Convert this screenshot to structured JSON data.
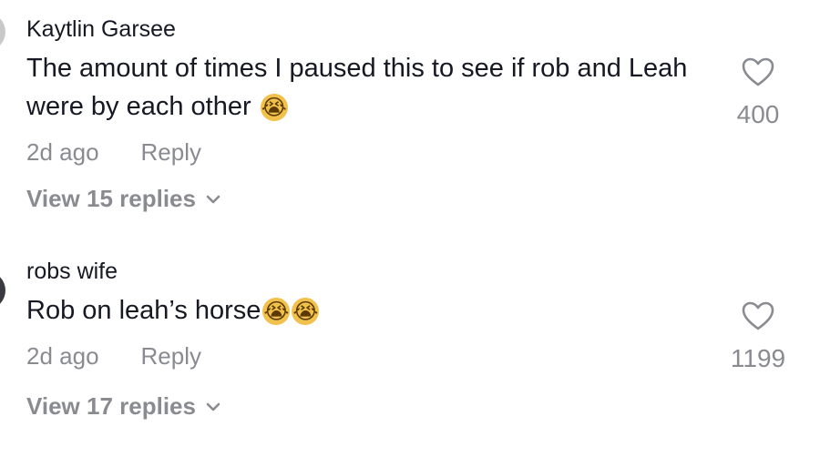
{
  "comments": [
    {
      "username": "Kaytlin Garsee",
      "text": "The amount of times I paused this to see if rob and Leah were by each other",
      "emojis": [
        "😭"
      ],
      "time": "2d ago",
      "reply_label": "Reply",
      "view_replies": "View 15 replies",
      "likes": "400",
      "like_icon": "heart-outline-icon",
      "chevron_icon": "chevron-down-icon"
    },
    {
      "username": "robs wife",
      "text": "Rob on leah’s horse",
      "emojis": [
        "😭",
        "😭"
      ],
      "time": "2d ago",
      "reply_label": "Reply",
      "view_replies": "View 17 replies",
      "likes": "1199",
      "like_icon": "heart-outline-icon",
      "chevron_icon": "chevron-down-icon"
    }
  ],
  "colors": {
    "primary_text": "#161823",
    "secondary_text": "#8a8b91",
    "background": "#ffffff"
  }
}
